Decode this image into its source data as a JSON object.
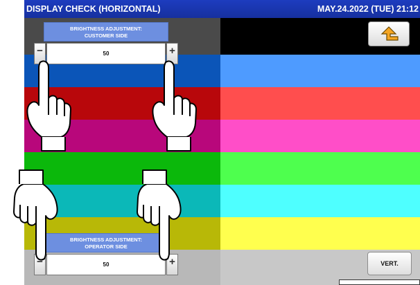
{
  "header": {
    "title": "DISPLAY CHECK (HORIZONTAL)",
    "datetime": "MAY.24.2022 (TUE) 21:12"
  },
  "colors": {
    "title_bar": "#1a36b0",
    "bands_left": [
      "#4a4a4a",
      "#0b55b8",
      "#b8070b",
      "#b8077b",
      "#0bb80b",
      "#0bb8b8",
      "#b8b807",
      "#b8b8b8"
    ],
    "bands_right": [
      "#000000",
      "#4e9bff",
      "#ff4e4e",
      "#ff4ec8",
      "#4eff4e",
      "#4effff",
      "#ffff4e",
      "#c8c8c8"
    ]
  },
  "customer_panel": {
    "title_line1": "BRIGHTNESS ADJUSTMENT:",
    "title_line2": "CUSTOMER SIDE",
    "value": "50",
    "minus": "−",
    "plus": "+"
  },
  "operator_panel": {
    "title_line1": "BRIGHTNESS ADJUSTMENT:",
    "title_line2": "OPERATOR SIDE",
    "value": "50",
    "minus": "−",
    "plus": "+"
  },
  "buttons": {
    "back_icon": "return-arrow-icon",
    "vert_label": "VERT."
  },
  "icons": {
    "hand": "pointing-hand-icon"
  }
}
